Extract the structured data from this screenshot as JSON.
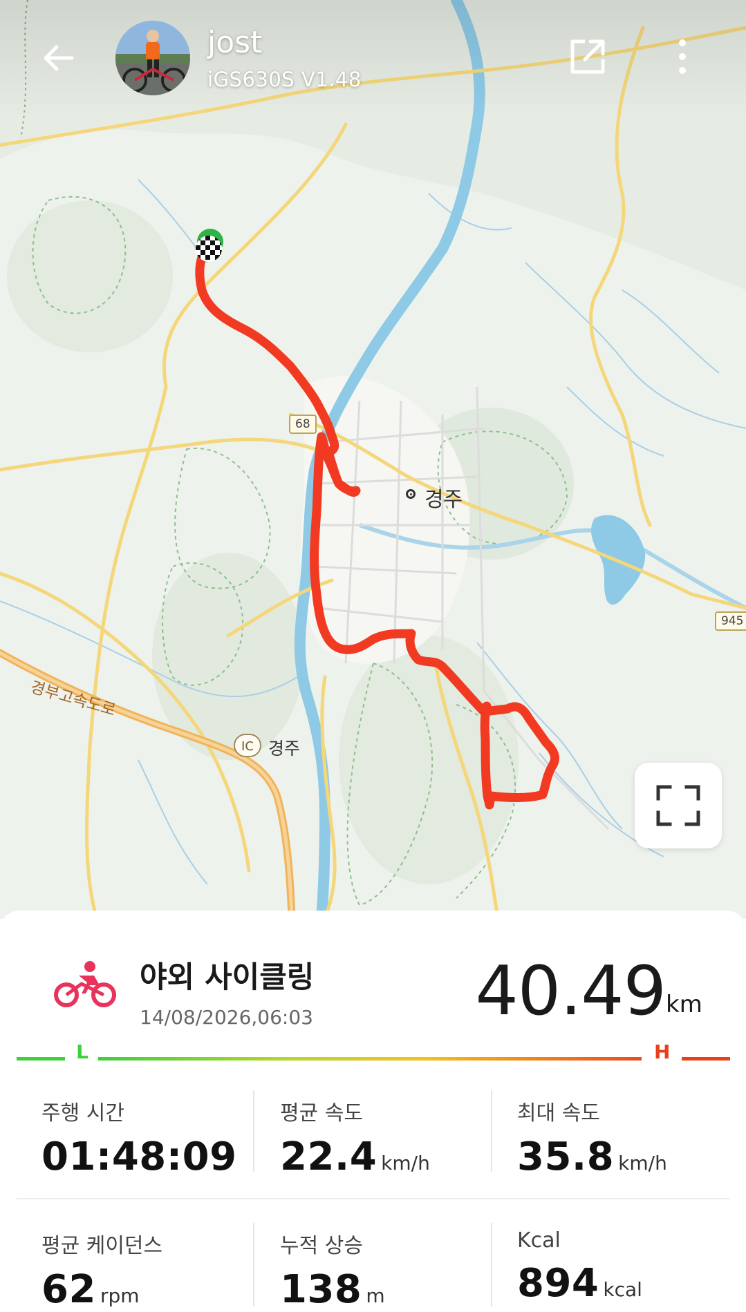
{
  "header": {
    "user_name": "jost",
    "device": "iGS630S  V1.48",
    "icons": {
      "back": "arrow-left-icon",
      "share": "share-external-icon",
      "more": "more-vertical-icon"
    }
  },
  "map": {
    "city_label": "경주",
    "ic_badge": "IC",
    "ic_label": "경주",
    "expressway_label": "경부고속도로",
    "route_shields": [
      "68",
      "945"
    ],
    "colors": {
      "route_line": "#f23a22",
      "water": "#8ecae6",
      "major_road": "#f4d77a",
      "expressway": "#f0b45a",
      "start_marker": "#2fb344"
    },
    "fullscreen_icon": "fullscreen-icon"
  },
  "activity": {
    "icon": "cycling-icon",
    "icon_color": "#e8335c",
    "title": "야외 사이클링",
    "datetime": "14/08/2026,06:03",
    "distance": "40.49",
    "distance_unit": "km",
    "intensity_low_label": "L",
    "intensity_high_label": "H"
  },
  "stats": [
    {
      "label": "주행 시간",
      "value": "01:48:09",
      "unit": ""
    },
    {
      "label": "평균 속도",
      "value": "22.4",
      "unit": "km/h"
    },
    {
      "label": "최대 속도",
      "value": "35.8",
      "unit": "km/h"
    },
    {
      "label": "평균 케이던스",
      "value": "62",
      "unit": "rpm"
    },
    {
      "label": "누적 상승",
      "value": "138",
      "unit": "m"
    },
    {
      "label": "Kcal",
      "value": "894",
      "unit": "kcal"
    }
  ]
}
